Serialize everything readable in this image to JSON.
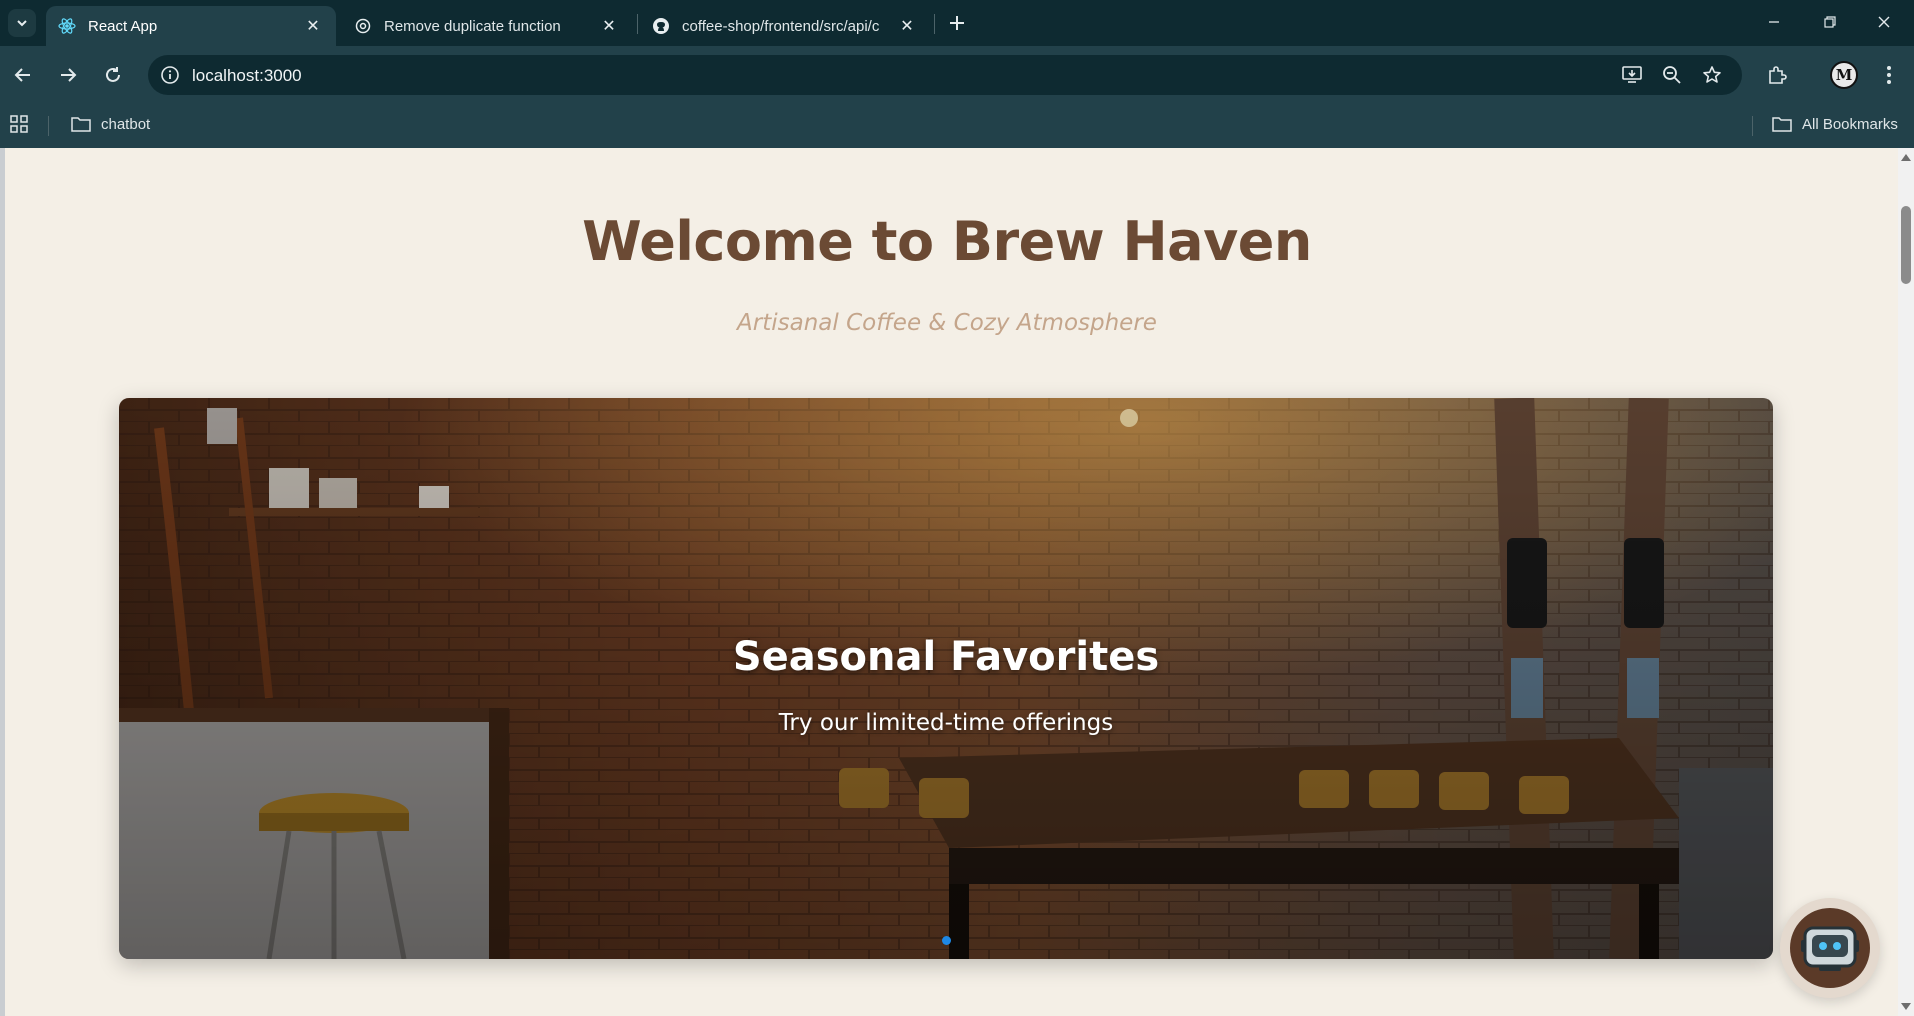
{
  "browser": {
    "tabs": [
      {
        "title": "React App",
        "favicon": "react-icon",
        "active": true
      },
      {
        "title": "Remove duplicate function",
        "favicon": "openai-icon",
        "active": false
      },
      {
        "title": "coffee-shop/frontend/src/api/c",
        "favicon": "github-icon",
        "active": false
      }
    ],
    "address": "localhost:3000",
    "bookmarks": {
      "folder": "chatbot",
      "all": "All Bookmarks"
    },
    "avatar_letter": "M"
  },
  "page": {
    "title": "Welcome to Brew Haven",
    "subtitle": "Artisanal Coffee & Cozy Atmosphere",
    "carousel": {
      "slide_title": "Seasonal Favorites",
      "slide_text": "Try our limited-time offerings",
      "dot_count": 1,
      "active_dot": 0
    },
    "chatbot": {
      "icon": "robot-icon"
    }
  },
  "colors": {
    "page_bg": "#f4efe6",
    "title": "#6b4a34",
    "subtitle": "#c4a58b",
    "accent_dot": "#1e88e5",
    "chatbot_bg": "#5b3a28"
  }
}
